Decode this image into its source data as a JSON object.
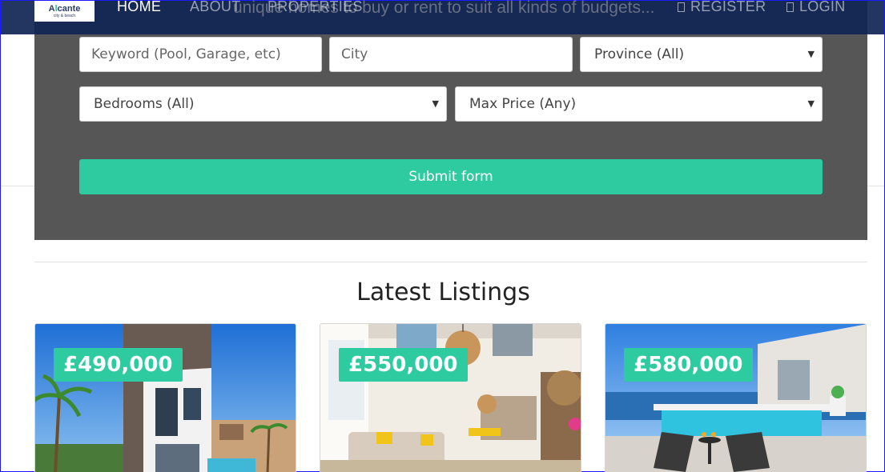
{
  "nav": {
    "logo_main_a": "A",
    "logo_main_b": "l",
    "logo_main_c": "cante",
    "logo_sub": "city & beach",
    "home": "HOME",
    "about": "ABOUT",
    "properties": "PROPERTIES",
    "register": "REGISTER",
    "login": "LOGIN"
  },
  "hero": {
    "tagline": "unique homes to buy or rent to suit all kinds of budgets..."
  },
  "search": {
    "keyword_placeholder": "Keyword (Pool, Garage, etc)",
    "city_placeholder": "City",
    "province": "Province (All)",
    "bedrooms": "Bedrooms (All)",
    "max_price": "Max Price (Any)",
    "submit": "Submit form"
  },
  "listings": {
    "title": "Latest Listings",
    "items": [
      {
        "price": "£490,000"
      },
      {
        "price": "£550,000"
      },
      {
        "price": "£580,000"
      }
    ]
  }
}
